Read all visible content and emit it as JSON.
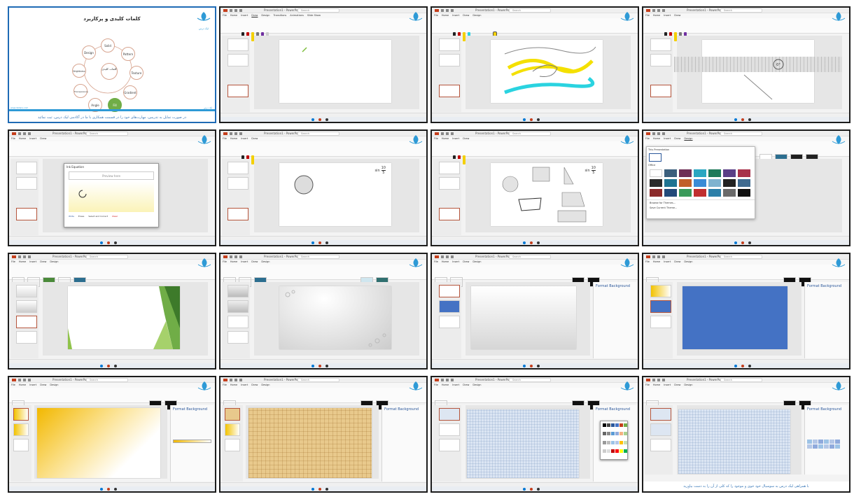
{
  "app_title": "Presentation1 - PowerPoint",
  "search_placeholder": "Search",
  "menu_tabs": [
    "File",
    "Home",
    "Insert",
    "Draw",
    "Design",
    "Transitions",
    "Animations",
    "Slide Show",
    "Record",
    "Review",
    "View",
    "Help"
  ],
  "logo_text": "لیک درس",
  "tile1": {
    "heading": "کلمات کلیدی و پرکاربرد",
    "center_label": "کلمات کلیدی",
    "nodes": [
      "Solid",
      "Pattern",
      "Texture",
      "Gradient",
      "Fill",
      "Angle",
      "Transparency",
      "Brightness",
      "Design"
    ],
    "footer_left": "www.likdars.com",
    "footer_right": "لیک درس",
    "caption": "در صورت تمایل به تدریس، مهارت‌های خود را در قسمت همکاری با ما در آکادمی لیک درس، ثبت نمائید"
  },
  "tile5": {
    "dialog_title": "Ink Equation",
    "preview_label": "Preview here",
    "buttons": [
      "Write",
      "Erase",
      "Select and Correct",
      "Clear"
    ]
  },
  "math_fraction": {
    "numerator": "10",
    "denominator": "5",
    "prefix": "sin"
  },
  "tile8": {
    "header": "This Presentation",
    "section": "Office",
    "links": [
      "Browse for Themes...",
      "Save Current Theme..."
    ]
  },
  "format_pane": {
    "title": "Format Background"
  },
  "tile16_caption": "با همراهی لیک درس به سوسیال خود خوی  و موجود را که کلی از آن را به دست بیاورید",
  "colors": {
    "accent": "#c43e1c",
    "brand_blue": "#2b579a",
    "fill_green": "#70ad47",
    "slide_blue": "#4472c4"
  }
}
